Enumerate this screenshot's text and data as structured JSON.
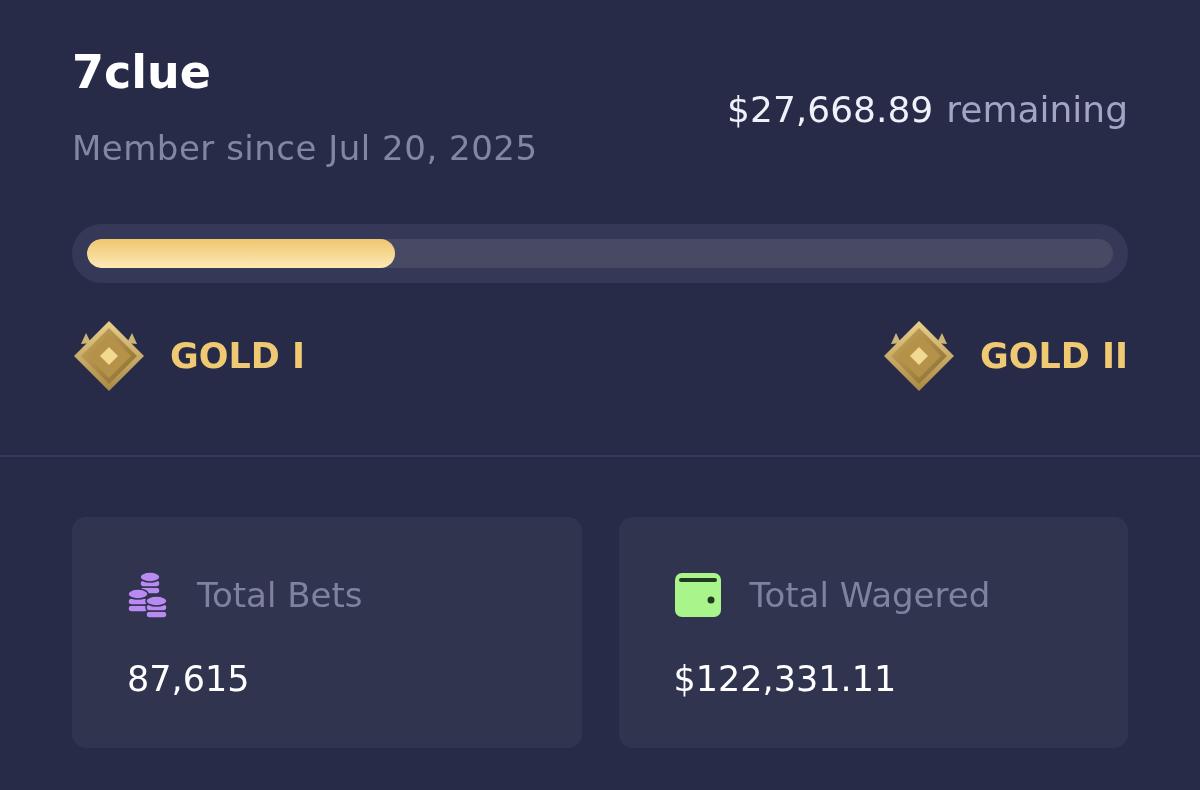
{
  "profile": {
    "username": "7clue",
    "member_since": "Member since Jul 20, 2025",
    "remaining_amount": "$27,668.89",
    "remaining_label": "remaining"
  },
  "progress": {
    "level": 0.3
  },
  "ranks": [
    {
      "label": "GOLD I"
    },
    {
      "label": "GOLD II"
    }
  ],
  "stats": [
    {
      "kind": "bets",
      "label": "Total Bets",
      "value": "87,615"
    },
    {
      "kind": "wagered",
      "label": "Total Wagered",
      "value": "$122,331.11"
    }
  ]
}
